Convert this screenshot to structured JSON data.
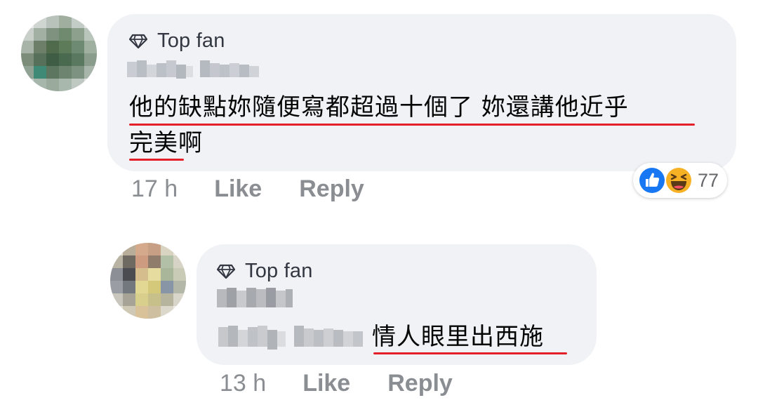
{
  "comments": [
    {
      "badge": "Top fan",
      "author": "Cindy Boon",
      "text_line1": "他的缺點妳隨便寫都超過十個了 妳還講他近乎",
      "text_line2_underlined": "完美",
      "text_line2_rest": "啊",
      "time": "17 h",
      "like_label": "Like",
      "reply_label": "Reply",
      "reactions": {
        "icons": [
          "like-icon",
          "haha-icon"
        ],
        "count": "77"
      }
    },
    {
      "badge": "Top fan",
      "author": "Hidden",
      "tagged_name": "Cindy Boon",
      "text_underlined": "情人眼里出西施",
      "time": "13 h",
      "like_label": "Like",
      "reply_label": "Reply"
    }
  ],
  "colors": {
    "bubble": "#f0f2f5",
    "meta_text": "#8a8d91",
    "underline": "#e3202a",
    "like_blue": "#1877f2",
    "haha_yellow": "#f7b125"
  }
}
